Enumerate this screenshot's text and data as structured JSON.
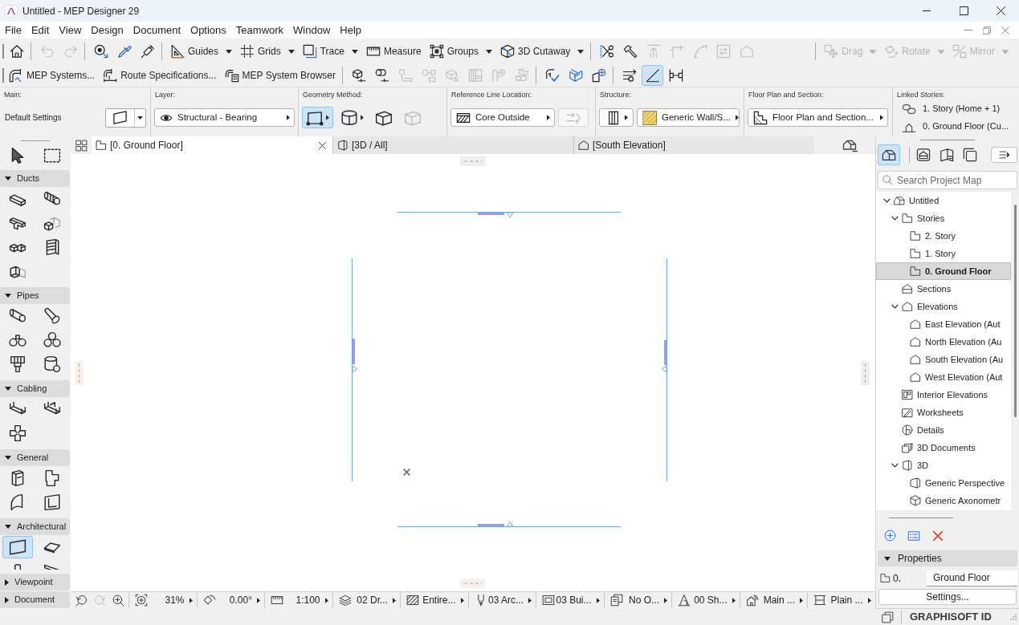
{
  "window": {
    "title": "Untitled - MEP Designer 29"
  },
  "menu_bar": [
    "File",
    "Edit",
    "View",
    "Design",
    "Document",
    "Options",
    "Teamwork",
    "Window",
    "Help"
  ],
  "standard_toolbar": {
    "groups": [
      [
        {
          "kind": "icon",
          "disabled": false
        }
      ],
      [
        {
          "kind": "icon",
          "disabled": true
        },
        {
          "kind": "icon",
          "disabled": true
        }
      ],
      [
        {
          "kind": "icon",
          "disabled": false
        },
        {
          "kind": "icon",
          "disabled": false
        },
        {
          "kind": "icon",
          "disabled": false
        }
      ],
      [
        {
          "kind": "labeled",
          "label": "Guides",
          "dropdown": true,
          "disabled": false
        },
        {
          "kind": "labeled",
          "label": "Grids",
          "dropdown": true,
          "disabled": false
        },
        {
          "kind": "labeled",
          "label": "Trace",
          "dropdown": true,
          "disabled": false
        },
        {
          "kind": "labeled",
          "label": "Measure",
          "dropdown": false,
          "disabled": false
        },
        {
          "kind": "labeled",
          "label": "Groups",
          "dropdown": true,
          "disabled": false
        },
        {
          "kind": "labeled",
          "label": "3D Cutaway",
          "dropdown": true,
          "disabled": false
        }
      ],
      [
        {
          "kind": "icon",
          "disabled": false
        },
        {
          "kind": "icon",
          "disabled": false
        },
        {
          "kind": "icon",
          "disabled": true
        },
        {
          "kind": "icon",
          "disabled": true
        },
        {
          "kind": "icon",
          "disabled": true
        },
        {
          "kind": "icon",
          "disabled": true
        },
        {
          "kind": "icon",
          "disabled": true
        }
      ],
      [
        {
          "kind": "labeled",
          "label": "Drag",
          "dropdown": true,
          "disabled": true
        },
        {
          "kind": "labeled",
          "label": "Rotate",
          "dropdown": true,
          "disabled": true
        },
        {
          "kind": "labeled",
          "label": "Mirror",
          "dropdown": true,
          "disabled": true
        }
      ]
    ]
  },
  "mep_toolbar": {
    "groups": [
      [
        {
          "kind": "labeled",
          "label": "MEP Systems...",
          "disabled": false
        },
        {
          "kind": "labeled",
          "label": "Route Specifications...",
          "disabled": false
        },
        {
          "kind": "labeled",
          "label": "MEP System Browser",
          "disabled": false
        }
      ],
      [
        {
          "kind": "icon",
          "disabled": false
        },
        {
          "kind": "icon",
          "disabled": false
        },
        {
          "kind": "icon",
          "disabled": true
        },
        {
          "kind": "icon",
          "disabled": true
        },
        {
          "kind": "icon",
          "disabled": true
        },
        {
          "kind": "icon",
          "disabled": true
        },
        {
          "kind": "icon",
          "disabled": true
        },
        {
          "kind": "icon",
          "disabled": true
        }
      ],
      [
        {
          "kind": "icon",
          "disabled": false
        },
        {
          "kind": "icon",
          "disabled": false
        },
        {
          "kind": "icon",
          "disabled": false
        }
      ],
      [
        {
          "kind": "icon",
          "disabled": false,
          "on": false
        },
        {
          "kind": "icon",
          "disabled": false,
          "on": true
        },
        {
          "kind": "icon",
          "disabled": false,
          "on": false
        }
      ]
    ]
  },
  "info_box": {
    "main": {
      "label": "Main:",
      "value": "Default Settings"
    },
    "layer": {
      "label": "Layer:",
      "value": "Structural - Bearing"
    },
    "geometry_method": {
      "label": "Geometry Method:",
      "options": [
        {
          "selected": true,
          "disabled": false
        },
        {
          "selected": false,
          "disabled": false
        },
        {
          "selected": false,
          "disabled": false
        },
        {
          "selected": false,
          "disabled": true
        }
      ]
    },
    "reference_line_location": {
      "label": "Reference Line Location:",
      "value": "Core Outside",
      "flip_button": {
        "disabled": true
      }
    },
    "structure": {
      "label": "Structure:",
      "value": "Generic Wall/S..."
    },
    "floor_plan_and_section": {
      "label": "Floor Plan and Section:",
      "value": "Floor Plan and Section..."
    },
    "linked_stories": {
      "label": "Linked Stories:",
      "items": [
        "1. Story (Home + 1)",
        "0. Ground Floor (Cu..."
      ]
    }
  },
  "toolbox": {
    "pointer_tools": [
      {
        "selected": false
      },
      {
        "selected": false
      }
    ],
    "groups": [
      {
        "label": "Ducts",
        "expanded": true,
        "tools": [
          {
            "selected": false
          },
          {
            "selected": false
          },
          {
            "selected": false
          },
          {
            "selected": false
          },
          {
            "selected": false
          },
          {
            "selected": false
          },
          {
            "selected": false
          }
        ]
      },
      {
        "label": "Pipes",
        "expanded": true,
        "tools": [
          {
            "selected": false
          },
          {
            "selected": false
          },
          {
            "selected": false
          },
          {
            "selected": false
          },
          {
            "selected": false
          },
          {
            "selected": false
          }
        ]
      },
      {
        "label": "Cabling",
        "expanded": true,
        "tools": [
          {
            "selected": false
          },
          {
            "selected": false
          },
          {
            "selected": false
          }
        ]
      },
      {
        "label": "General",
        "expanded": true,
        "tools": [
          {
            "selected": false
          },
          {
            "selected": false
          },
          {
            "selected": false
          },
          {
            "selected": false
          }
        ]
      },
      {
        "label": "Architectural",
        "expanded": true,
        "tools": [
          {
            "selected": true
          },
          {
            "selected": false
          },
          {
            "selected": false
          },
          {
            "selected": false
          }
        ]
      },
      {
        "label": "Viewpoint",
        "expanded": false
      },
      {
        "label": "Document",
        "expanded": false
      }
    ]
  },
  "view_tabs": [
    {
      "label": "[0. Ground Floor]",
      "selected": true
    },
    {
      "label": "[3D / All]",
      "selected": false
    },
    {
      "label": "[South Elevation]",
      "selected": false
    }
  ],
  "status_bar": {
    "nav": [
      {
        "disabled": false
      },
      {
        "disabled": true
      },
      {
        "disabled": false
      }
    ],
    "fields": [
      "31%",
      "0.00°",
      "1:100",
      "02 Dr...",
      "Entire...",
      "03 Arc...",
      "03 Bui...",
      "No O...",
      "00 Sh...",
      "Main ...",
      "Plain ..."
    ]
  },
  "navigator": {
    "tabs": [
      {
        "selected": true
      },
      {
        "selected": false
      },
      {
        "selected": false
      },
      {
        "selected": false
      }
    ],
    "search": {
      "placeholder": "Search Project Map"
    },
    "tree": [
      {
        "kind": "project",
        "label": "Untitled",
        "expanded": true,
        "selected": false,
        "children": [
          {
            "kind": "stories",
            "label": "Stories",
            "expanded": true,
            "selected": false,
            "children": [
              {
                "kind": "story",
                "label": "2. Story",
                "selected": false
              },
              {
                "kind": "story",
                "label": "1. Story",
                "selected": false
              },
              {
                "kind": "story",
                "label": "0. Ground Floor",
                "selected": true
              }
            ]
          },
          {
            "kind": "sections",
            "label": "Sections",
            "selected": false
          },
          {
            "kind": "elevations",
            "label": "Elevations",
            "expanded": true,
            "selected": false,
            "children": [
              {
                "kind": "elevation",
                "label": "East Elevation (Aut",
                "selected": false
              },
              {
                "kind": "elevation",
                "label": "North Elevation (Au",
                "selected": false
              },
              {
                "kind": "elevation",
                "label": "South Elevation (Au",
                "selected": false
              },
              {
                "kind": "elevation",
                "label": "West Elevation (Aut",
                "selected": false
              }
            ]
          },
          {
            "kind": "interior_elevations",
            "label": "Interior Elevations",
            "selected": false
          },
          {
            "kind": "worksheets",
            "label": "Worksheets",
            "selected": false
          },
          {
            "kind": "details",
            "label": "Details",
            "selected": false
          },
          {
            "kind": "documents_3d",
            "label": "3D Documents",
            "selected": false
          },
          {
            "kind": "views_3d",
            "label": "3D",
            "expanded": true,
            "selected": false,
            "children": [
              {
                "kind": "perspective",
                "label": "Generic Perspective",
                "selected": false
              },
              {
                "kind": "axonometry",
                "label": "Generic Axonometr",
                "selected": false
              }
            ]
          }
        ]
      }
    ],
    "properties": {
      "label": "Properties",
      "expanded": true,
      "number": "0.",
      "name": "Ground Floor",
      "settings_button": "Settings..."
    },
    "footer": {
      "brand": "GRAPHISOFT ID"
    }
  }
}
